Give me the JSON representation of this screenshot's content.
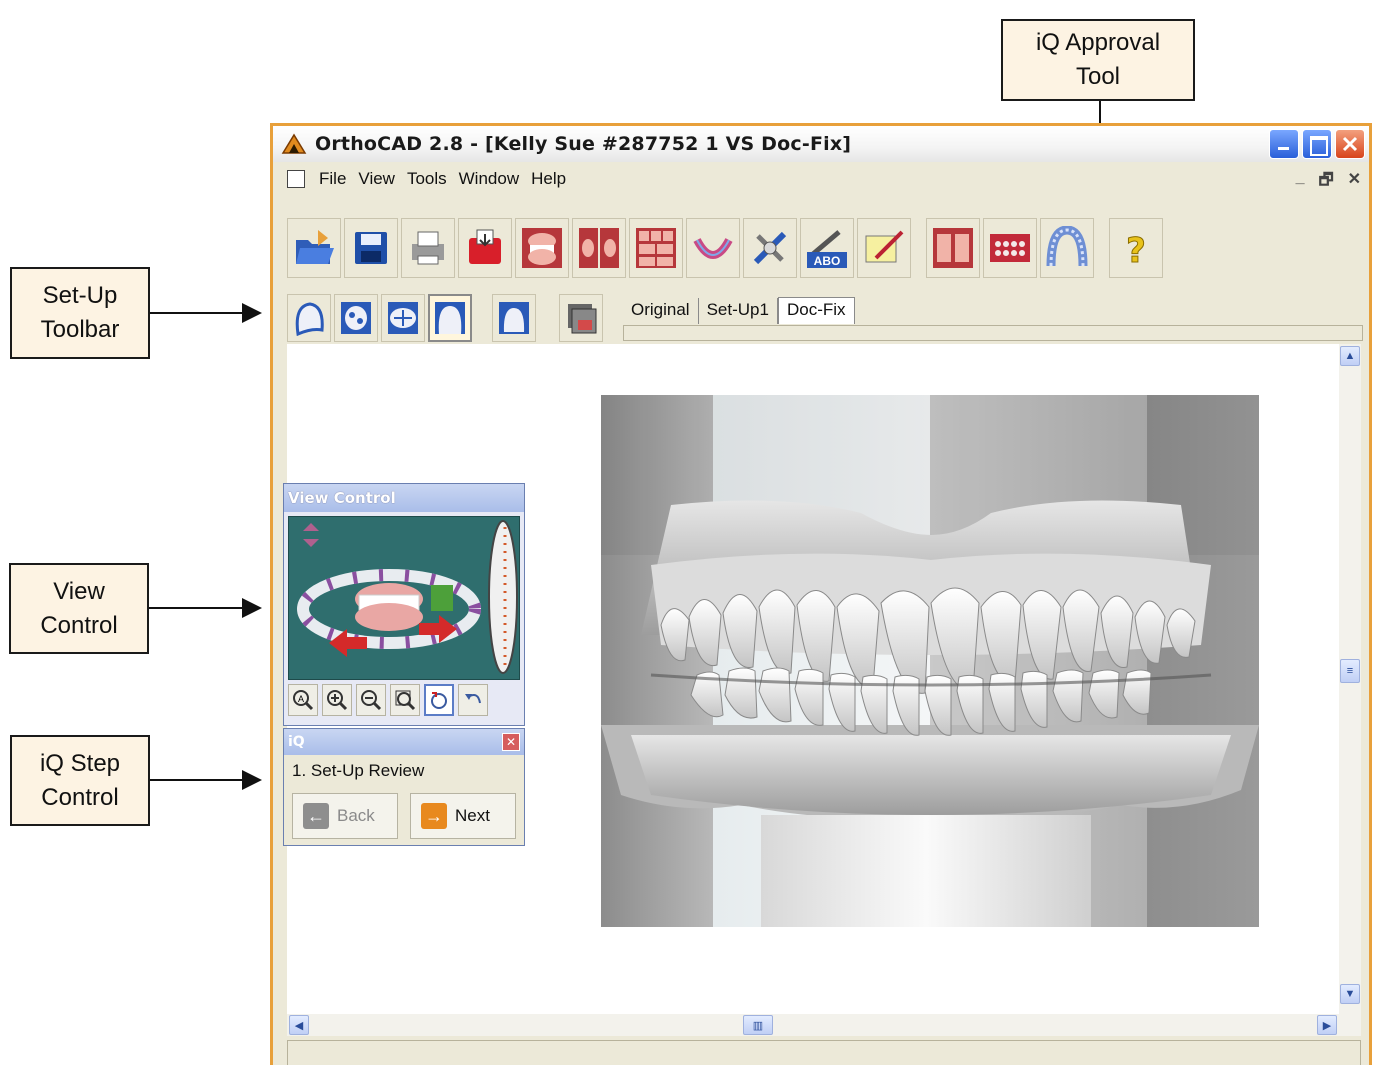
{
  "callouts": {
    "approval": "iQ Approval\nTool",
    "setup_toolbar": "Set-Up\nToolbar",
    "view_control": "View\nControl",
    "step_control": "iQ Step\nControl"
  },
  "window": {
    "title": "OrthoCAD 2.8 - [Kelly Sue #287752 1 VS Doc-Fix]",
    "menu": [
      "File",
      "View",
      "Tools",
      "Window",
      "Help"
    ],
    "mdi_buttons": [
      "_",
      "🗗",
      "✕"
    ]
  },
  "toolbar": {
    "icons": [
      "open-folder-icon",
      "save-disk-icon",
      "print-icon",
      "export-icon",
      "jaw-model-icon",
      "split-view-icon",
      "grid-view-icon",
      "arch-wire-icon",
      "measure-tool-icon",
      "abo-score-icon",
      "notes-pen-icon",
      "dual-jaw-icon",
      "brackets-icon",
      "iq-approval-icon",
      "help-icon"
    ]
  },
  "setup_tabs": [
    "Original",
    "Set-Up1",
    "Doc-Fix"
  ],
  "setup_active_tab": "Doc-Fix",
  "view_control": {
    "title": "View Control"
  },
  "iq_panel": {
    "title": "iQ",
    "close": "✕",
    "step": "1. Set-Up Review",
    "back": "Back",
    "next": "Next"
  },
  "colors": {
    "window_border": "#e8a03a",
    "callout_bg": "#fdf3e3",
    "panel_title": "#a9bde9"
  }
}
